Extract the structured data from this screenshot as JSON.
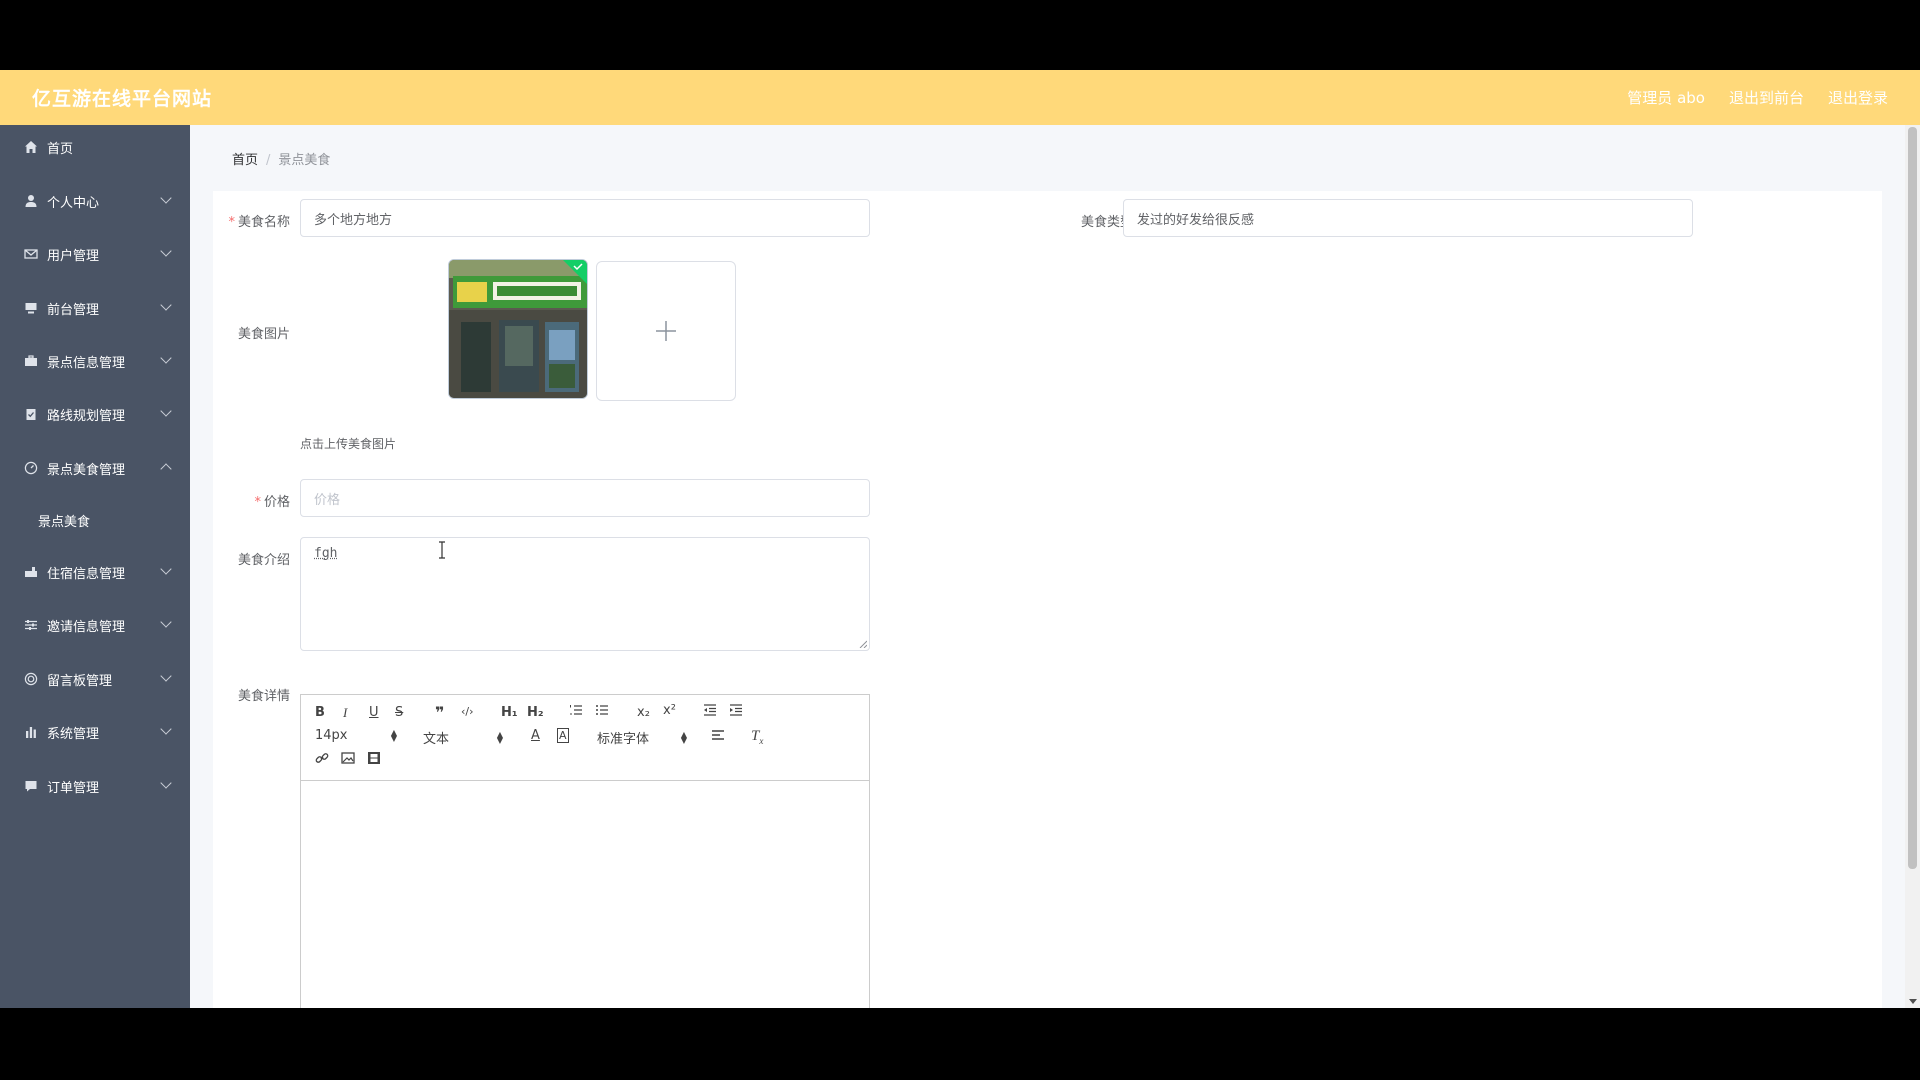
{
  "header": {
    "site_title": "亿互游在线平台网站",
    "admin_label": "管理员 abo",
    "back_to_front": "退出到前台",
    "logout": "退出登录"
  },
  "sidebar": {
    "items": [
      {
        "label": "首页",
        "icon": "home-icon"
      },
      {
        "label": "个人中心",
        "icon": "user-icon"
      },
      {
        "label": "用户管理",
        "icon": "mail-icon"
      },
      {
        "label": "前台管理",
        "icon": "monitor-icon"
      },
      {
        "label": "景点信息管理",
        "icon": "briefcase-icon"
      },
      {
        "label": "路线规划管理",
        "icon": "clipboard-icon"
      },
      {
        "label": "景点美食管理",
        "icon": "compass-icon"
      },
      {
        "label": "住宿信息管理",
        "icon": "hotel-icon"
      },
      {
        "label": "邀请信息管理",
        "icon": "sliders-icon"
      },
      {
        "label": "留言板管理",
        "icon": "target-icon"
      },
      {
        "label": "系统管理",
        "icon": "bar-chart-icon"
      },
      {
        "label": "订单管理",
        "icon": "comment-icon"
      }
    ],
    "sub_item": "景点美食"
  },
  "breadcrumb": {
    "home": "首页",
    "separator": "/",
    "current": "景点美食"
  },
  "form": {
    "name_label": "美食名称",
    "name_value": "多个地方地方",
    "type_label": "美食类型",
    "type_value": "发过的好发给很反感",
    "image_label": "美食图片",
    "upload_hint": "点击上传美食图片",
    "price_label": "价格",
    "price_placeholder": "价格",
    "intro_label": "美食介绍",
    "intro_value": "fgh",
    "detail_label": "美食详情",
    "required_mark": "*"
  },
  "editor": {
    "font_size": "14px",
    "paragraph": "文本",
    "font_family": "标准字体"
  },
  "colors": {
    "header_bg": "#ffd97a",
    "sidebar_bg": "#4a5465",
    "required": "#f56c6c"
  }
}
